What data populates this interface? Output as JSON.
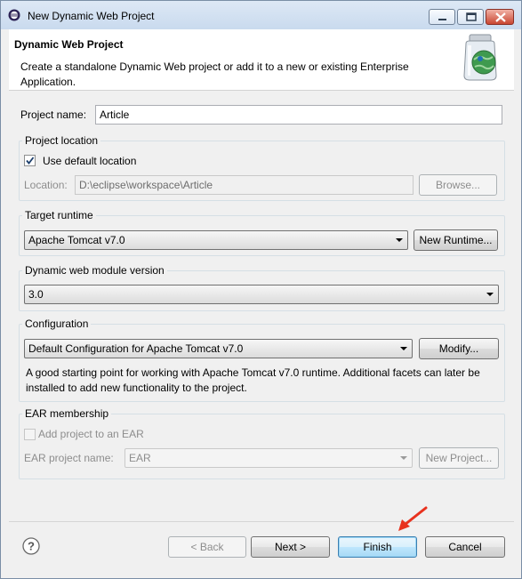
{
  "window": {
    "title": "New Dynamic Web Project",
    "app_icon": "eclipse-icon",
    "controls": [
      "minimize-icon",
      "maximize-icon",
      "close-icon"
    ]
  },
  "header": {
    "title": "Dynamic Web Project",
    "description": "Create a standalone Dynamic Web project or add it to a new or existing Enterprise Application.",
    "icon": "web-project-jar-globe-icon"
  },
  "project_name": {
    "label": "Project name:",
    "value": "Article"
  },
  "project_location": {
    "group_title": "Project location",
    "use_default_label": "Use default location",
    "use_default_checked": true,
    "location_label": "Location:",
    "location_value": "D:\\eclipse\\workspace\\Article",
    "browse_label": "Browse..."
  },
  "target_runtime": {
    "group_title": "Target runtime",
    "selected": "Apache Tomcat v7.0",
    "new_runtime_label": "New Runtime..."
  },
  "module_version": {
    "group_title": "Dynamic web module version",
    "selected": "3.0"
  },
  "configuration": {
    "group_title": "Configuration",
    "selected": "Default Configuration for Apache Tomcat v7.0",
    "modify_label": "Modify...",
    "description": "A good starting point for working with Apache Tomcat v7.0 runtime. Additional facets can later be installed to add new functionality to the project."
  },
  "ear": {
    "group_title": "EAR membership",
    "add_label": "Add project to an EAR",
    "add_checked": false,
    "project_name_label": "EAR project name:",
    "project_name_value": "EAR",
    "new_project_label": "New Project..."
  },
  "footer": {
    "help_icon": "help-icon",
    "back_label": "< Back",
    "next_label": "Next >",
    "finish_label": "Finish",
    "cancel_label": "Cancel"
  },
  "annotation": {
    "icon": "red-arrow-pointer-icon",
    "color": "#e8321e"
  }
}
